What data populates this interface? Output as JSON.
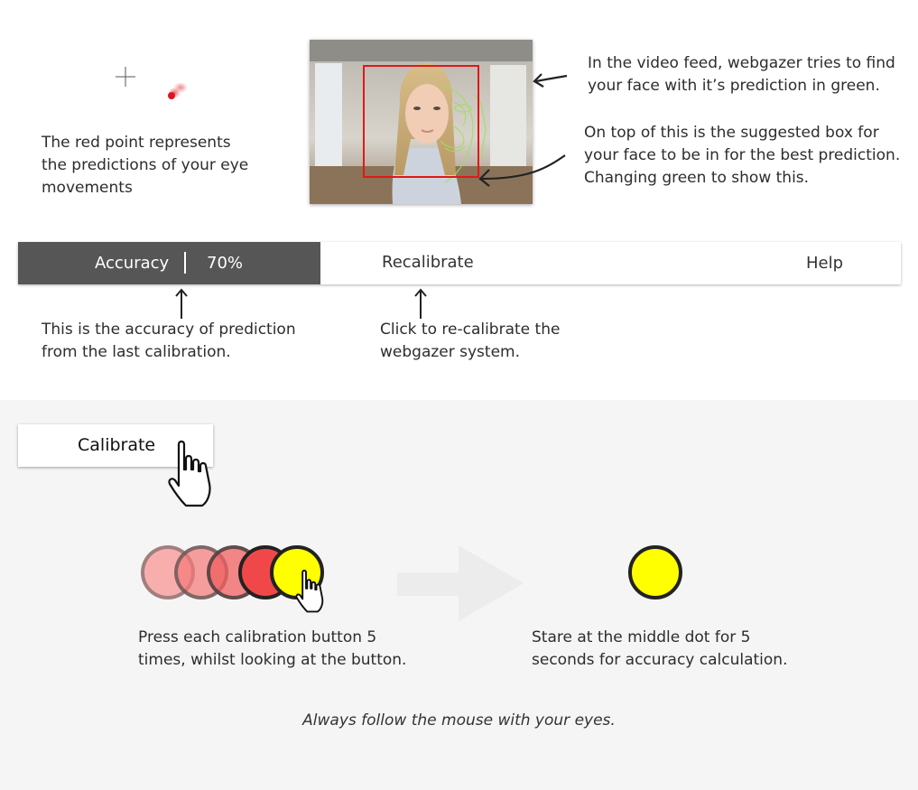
{
  "annotations": {
    "red_point": "The red point represents the predictions of your eye movements",
    "video_feed": "In the video feed, webgazer tries to find your face with it’s prediction in green.",
    "face_box": "On top of this is the suggested box for your face to be in for the best prediction. Changing green to show this.",
    "accuracy": "This is the accuracy of prediction from the last calibration.",
    "recalibrate": "Click to re-calibrate the webgazer system.",
    "press_buttons": "Press each calibration button 5 times, whilst looking at the button.",
    "stare": "Stare at the middle dot for 5 seconds for accuracy calculation.",
    "follow_mouse": "Always follow the mouse with your eyes."
  },
  "toolbar": {
    "accuracy_label": "Accuracy",
    "accuracy_value": "70%",
    "recalibrate_label": "Recalibrate",
    "help_label": "Help"
  },
  "calibrate_button": {
    "label": "Calibrate"
  },
  "colors": {
    "toolbar_dark": "#565656",
    "prediction_point": "#e0141e",
    "face_box": "#e01818",
    "face_mesh": "#9be05a",
    "calibration_dot_final": "#ffff00"
  },
  "icons": [
    "crosshair-icon",
    "hand-pointer-icon",
    "arrow-right-icon",
    "arrow-up-icon"
  ]
}
